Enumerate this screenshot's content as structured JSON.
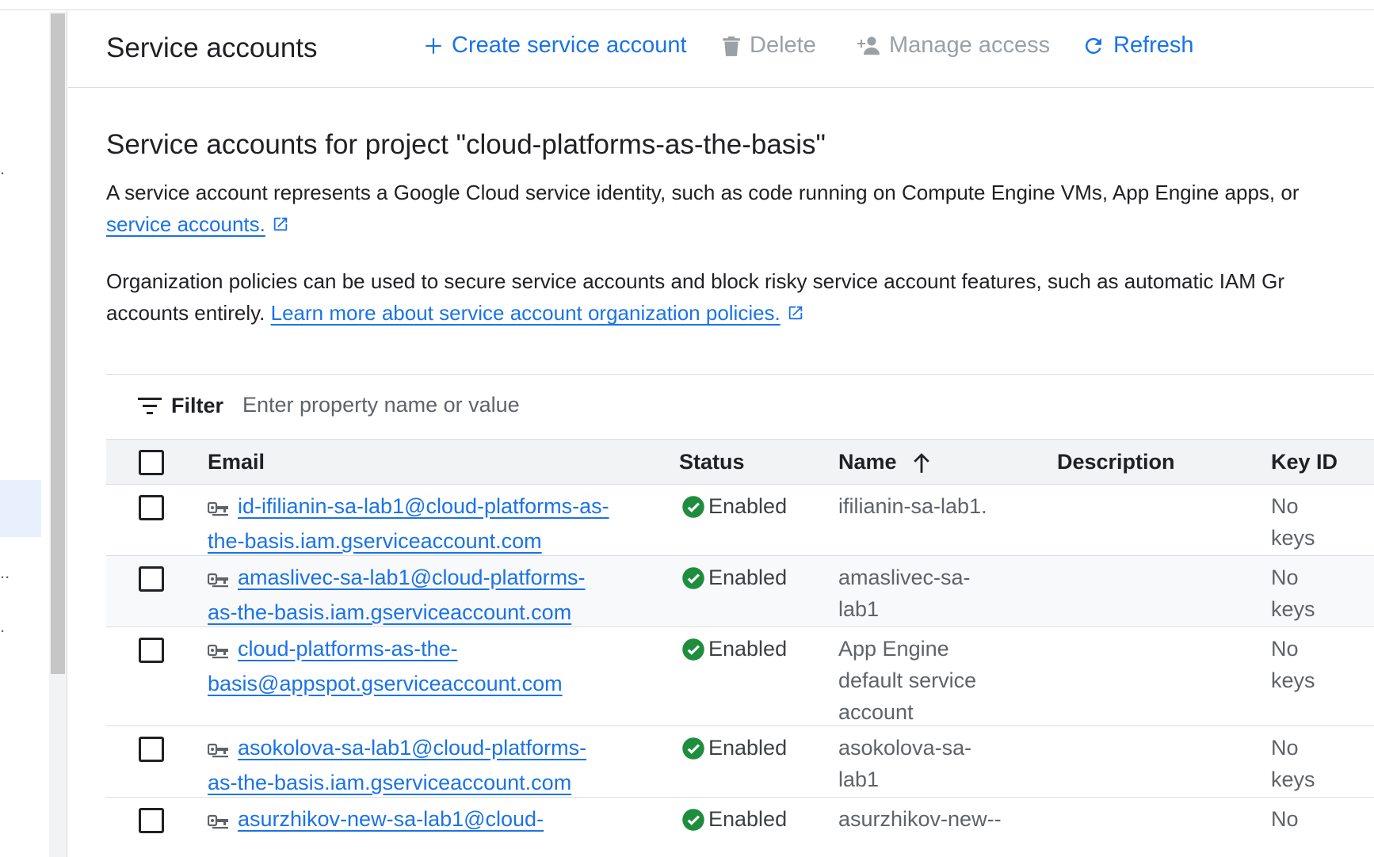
{
  "toolbar": {
    "title": "Service accounts",
    "create_label": "Create service account",
    "delete_label": "Delete",
    "manage_access_label": "Manage access",
    "refresh_label": "Refresh"
  },
  "intro": {
    "heading": "Service accounts for project \"cloud-platforms-as-the-basis\"",
    "para1_text": "A service account represents a Google Cloud service identity, such as code running on Compute Engine VMs, App Engine apps, or",
    "para1_link": "service accounts.",
    "para2_text": "Organization policies can be used to secure service accounts and block risky service account features, such as automatic IAM Gr",
    "para2_text2": "accounts entirely.",
    "para2_link": "Learn more about service account organization policies."
  },
  "filter": {
    "label": "Filter",
    "placeholder": "Enter property name or value"
  },
  "table": {
    "headers": {
      "email": "Email",
      "status": "Status",
      "name": "Name",
      "description": "Description",
      "key_id": "Key ID"
    },
    "rows": [
      {
        "email_line1": "id-ifilianin-sa-lab1@cloud-platforms-as-",
        "email_line2": "the-basis.iam.gserviceaccount.com",
        "status": "Enabled",
        "name_lines": [
          "ifilianin-sa-lab1."
        ],
        "key_lines": [
          "No",
          "keys"
        ]
      },
      {
        "email_line1": "amaslivec-sa-lab1@cloud-platforms-",
        "email_line2": "as-the-basis.iam.gserviceaccount.com",
        "status": "Enabled",
        "name_lines": [
          "amaslivec-sa-",
          "lab1"
        ],
        "key_lines": [
          "No",
          "keys"
        ]
      },
      {
        "email_line1": "cloud-platforms-as-the-",
        "email_line2": "basis@appspot.gserviceaccount.com",
        "status": "Enabled",
        "name_lines": [
          "App Engine",
          "default service",
          "account"
        ],
        "key_lines": [
          "No",
          "keys"
        ]
      },
      {
        "email_line1": "asokolova-sa-lab1@cloud-platforms-",
        "email_line2": "as-the-basis.iam.gserviceaccount.com",
        "status": "Enabled",
        "name_lines": [
          "asokolova-sa-",
          "lab1"
        ],
        "key_lines": [
          "No",
          "keys"
        ]
      },
      {
        "email_line1": "asurzhikov-new-sa-lab1@cloud-",
        "email_line2": "",
        "status": "Enabled",
        "name_lines": [
          "asurzhikov-new--"
        ],
        "key_lines": [
          "No"
        ]
      }
    ]
  },
  "colors": {
    "accent": "#1a73e8",
    "disabled": "#9aa0a6",
    "success": "#1e8e3e"
  }
}
